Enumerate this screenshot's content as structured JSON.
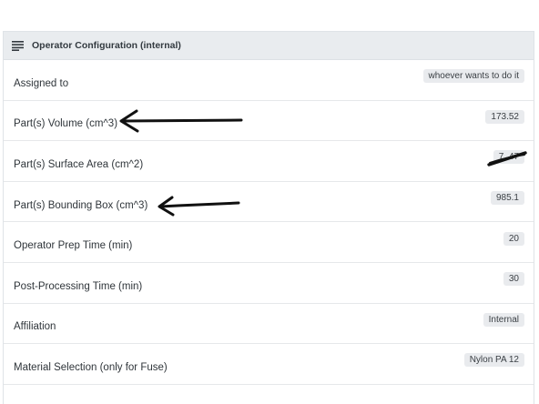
{
  "panel": {
    "title": "Operator Configuration (internal)",
    "icon": "list-lines-icon"
  },
  "rows": [
    {
      "label": "Assigned to",
      "value": "whoever wants to do it"
    },
    {
      "label": "Part(s) Volume (cm^3)",
      "value": "173.52"
    },
    {
      "label": "Part(s) Surface Area (cm^2)",
      "value": "7 .47"
    },
    {
      "label": "Part(s) Bounding Box (cm^3)",
      "value": "985.1"
    },
    {
      "label": "Operator Prep Time (min)",
      "value": "20"
    },
    {
      "label": "Post-Processing Time (min)",
      "value": "30"
    },
    {
      "label": "Affiliation",
      "value": "Internal"
    },
    {
      "label": "Material Selection (only for Fuse)",
      "value": "Nylon PA 12"
    }
  ],
  "annotations": {
    "ink_color": "#111111",
    "arrows": [
      "hand-drawn-arrow-volume",
      "hand-drawn-arrow-bounding-box"
    ],
    "strike": "scribble-over-surface-area-value"
  }
}
